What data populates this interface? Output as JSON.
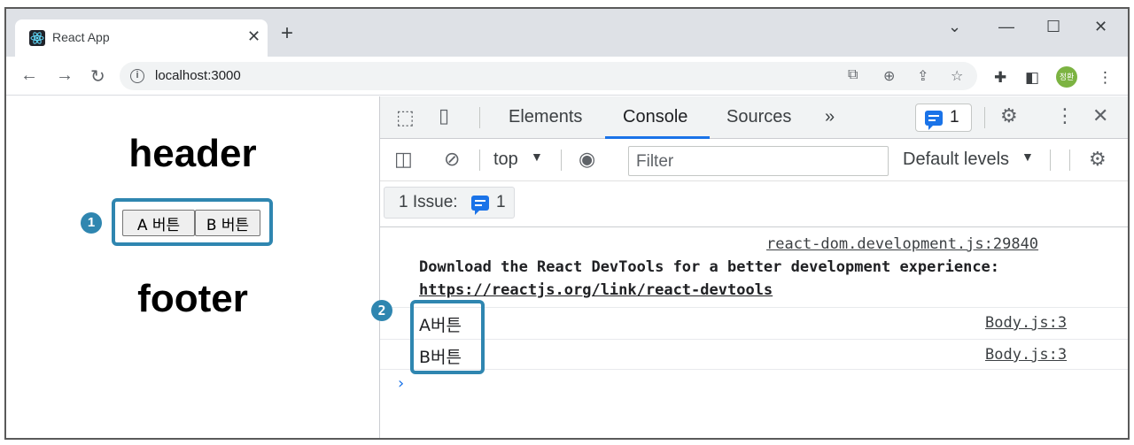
{
  "browser": {
    "tab_title": "React App",
    "url": "localhost:3000",
    "profile_initials": "정환"
  },
  "page": {
    "header": "header",
    "footer": "footer",
    "button_a": "A 버튼",
    "button_b": "B 버튼",
    "badge_1": "1",
    "badge_2": "2"
  },
  "devtools": {
    "tabs": [
      "Elements",
      "Console",
      "Sources"
    ],
    "active_tab": "Console",
    "more_tabs": "»",
    "issues_badge_count": "1",
    "context": "top",
    "filter_placeholder": "Filter",
    "levels": "Default levels",
    "issue_label": "1 Issue:",
    "issue_count": "1"
  },
  "console": {
    "messages": [
      {
        "source": "react-dom.development.js:29840",
        "text": "Download the React DevTools for a better development experience:",
        "link": "https://reactjs.org/link/react-devtools"
      },
      {
        "text": "A버튼",
        "source": "Body.js:3"
      },
      {
        "text": "B버튼",
        "source": "Body.js:3"
      }
    ],
    "prompt": "›"
  },
  "colors": {
    "annotation": "#2f86b0",
    "accent": "#1a73e8",
    "tabstrip": "#dee1e6"
  }
}
